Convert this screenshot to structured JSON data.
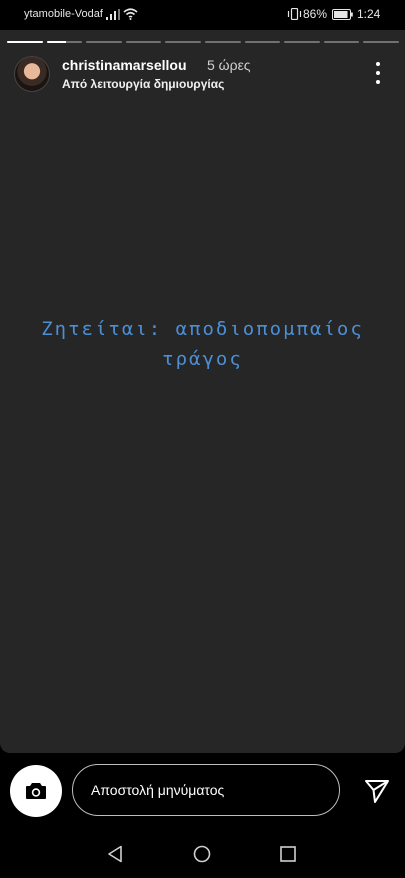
{
  "status_bar": {
    "carrier": "ytamobile-Vodaf",
    "battery": "86%",
    "time": "1:24"
  },
  "story": {
    "segment_count": 10,
    "segments_progress": [
      1,
      0.55,
      0,
      0,
      0,
      0,
      0,
      0,
      0,
      0
    ],
    "username": "christinamarsellou",
    "time_ago": "5 ώρες",
    "subtitle": "Από λειτουργία δημιουργίας",
    "text_line1": "Ζητείται: αποδιοπομπαίος",
    "text_line2": "τράγος",
    "text_color": "#4b8fd6",
    "background": "#262626"
  },
  "reply": {
    "placeholder": "Αποστολή μηνύματος"
  },
  "icons": {
    "camera": "camera-icon",
    "send": "send-icon",
    "more": "more-vertical-icon",
    "back": "back-icon",
    "home": "home-icon",
    "recent": "recent-apps-icon"
  }
}
